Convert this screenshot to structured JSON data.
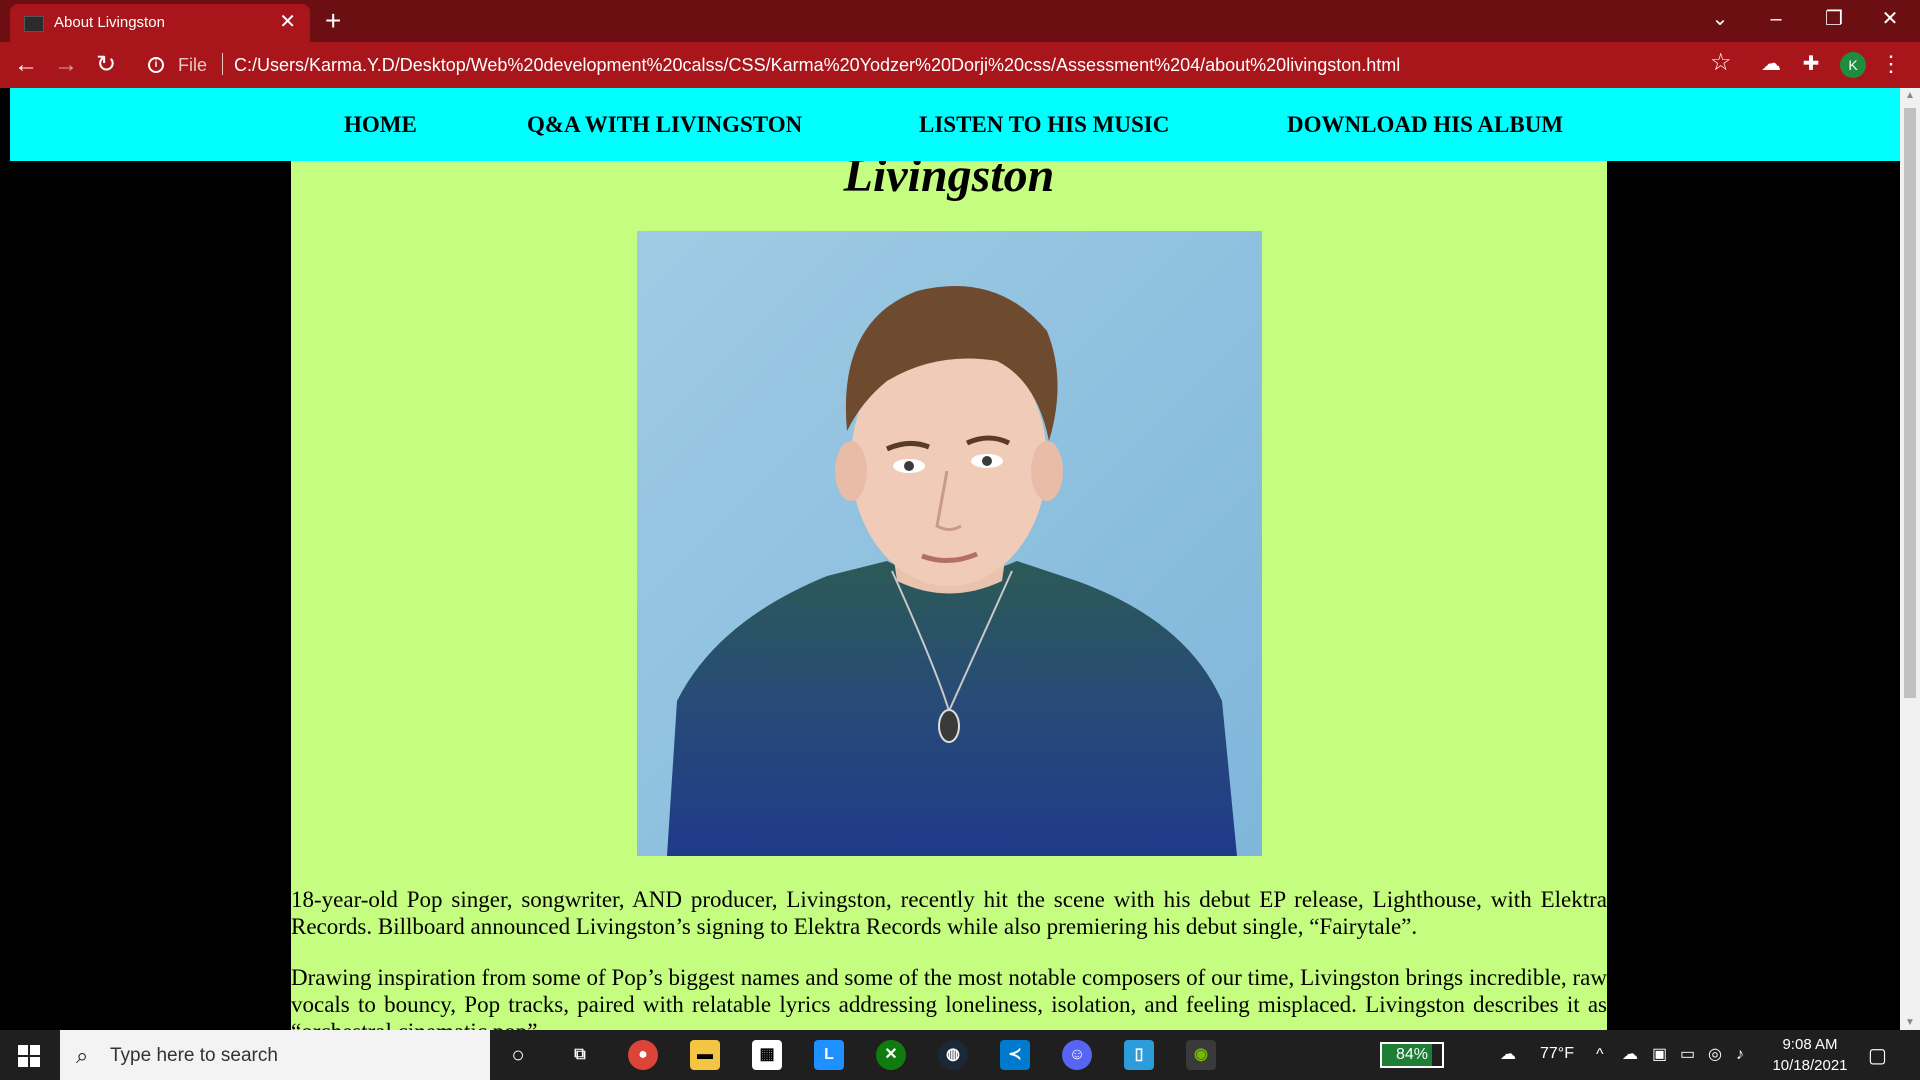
{
  "browser": {
    "tab_title": "About Livingston",
    "tab_close": "✕",
    "new_tab": "+",
    "scheme_label": "File",
    "url": "C:/Users/Karma.Y.D/Desktop/Web%20development%20calss/CSS/Karma%20Yodzer%20Dorji%20css/Assessment%204/about%20livingston.html",
    "profile_initial": "K",
    "icons": [
      "back-icon",
      "forward-icon",
      "reload-icon",
      "info-icon",
      "star-icon",
      "extensions-icon",
      "menu-icon",
      "minimize-icon",
      "restore-icon",
      "close-icon",
      "tab-search-icon"
    ]
  },
  "nav": {
    "items": [
      {
        "label": "HOME"
      },
      {
        "label": "Q&A WITH LIVINGSTON"
      },
      {
        "label": "LISTEN TO HIS MUSIC"
      },
      {
        "label": "DOWNLOAD HIS ALBUM"
      }
    ],
    "background": "#00ffff"
  },
  "page": {
    "heading": "Livingston",
    "background": "#c5fd80",
    "photo_alt": "Portrait photo of Livingston",
    "paragraphs": [
      "18-year-old Pop singer, songwriter, AND producer, Livingston, recently hit the scene with his debut EP release, Lighthouse, with Elektra Records. Billboard announced Livingston’s signing to Elektra Records while also premiering his debut single, “Fairytale”.",
      "Drawing inspiration from some of Pop’s biggest names and some of the most notable composers of our time, Livingston brings incredible, raw vocals to bouncy, Pop tracks, paired with relatable lyrics addressing loneliness, isolation, and feeling misplaced. Livingston describes it as “orchestral cinematic pop”."
    ]
  },
  "taskbar": {
    "search_placeholder": "Type here to search",
    "battery": "84%",
    "battery_level": 0.84,
    "temperature": "77°F",
    "time": "9:08 AM",
    "date": "10/18/2021",
    "pinned_apps": [
      "cortana-icon",
      "task-view-icon",
      "chrome-icon",
      "file-explorer-icon",
      "store-icon",
      "l-app-icon",
      "xbox-icon",
      "steam-icon",
      "vscode-icon",
      "discord-icon",
      "phone-app-icon",
      "nvidia-icon"
    ]
  }
}
